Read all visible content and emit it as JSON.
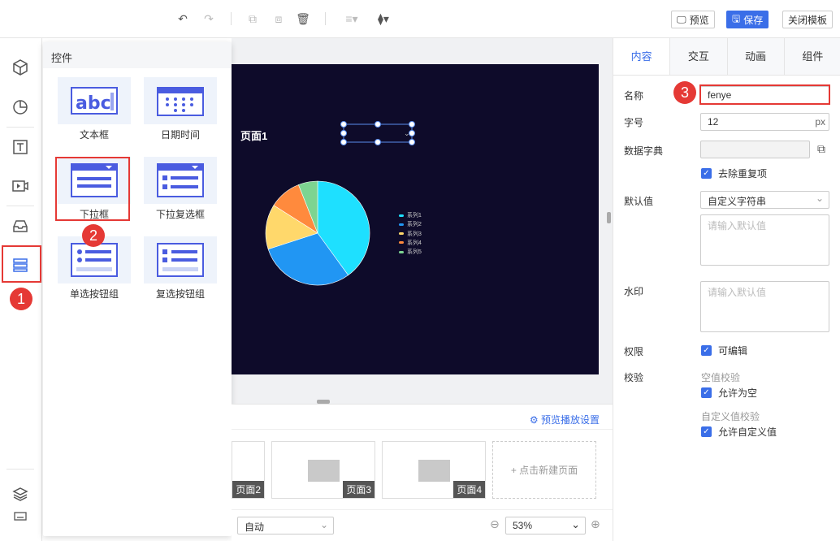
{
  "toolbar": {
    "preview_label": "预览",
    "save_label": "保存",
    "close_label": "关闭模板"
  },
  "panel": {
    "title": "控件",
    "controls": [
      {
        "label": "文本框"
      },
      {
        "label": "日期时间"
      },
      {
        "label": "下拉框"
      },
      {
        "label": "下拉复选框"
      },
      {
        "label": "单选按钮组"
      },
      {
        "label": "复选按钮组"
      }
    ]
  },
  "canvas": {
    "page_title": "页面1",
    "legend": [
      "系列1",
      "系列2",
      "系列3",
      "系列4",
      "系列5"
    ],
    "colors": [
      "#1ee0ff",
      "#2196f3",
      "#ffd86b",
      "#ff8a3d",
      "#7dd491"
    ]
  },
  "chart_data": {
    "type": "pie",
    "categories": [
      "系列1",
      "系列2",
      "系列3",
      "系列4",
      "系列5"
    ],
    "values": [
      40,
      30,
      14,
      10,
      6
    ]
  },
  "pages": {
    "preview_settings": "预览播放设置",
    "items": [
      "页面2",
      "页面3",
      "页面4"
    ],
    "new_page": "+ 点击新建页面",
    "auto_select": "自动",
    "zoom": "53%"
  },
  "rightpanel": {
    "tabs": [
      "内容",
      "交互",
      "动画",
      "组件"
    ],
    "name_label": "名称",
    "name_value": "fenye",
    "fontsize_label": "字号",
    "fontsize_value": "12",
    "fontsize_unit": "px",
    "dict_label": "数据字典",
    "dedupe_label": "去除重复项",
    "default_label": "默认值",
    "default_select": "自定义字符串",
    "default_placeholder": "请输入默认值",
    "watermark_label": "水印",
    "watermark_placeholder": "请输入默认值",
    "perm_label": "权限",
    "editable_label": "可编辑",
    "validate_label": "校验",
    "null_check": "空值校验",
    "allow_null": "允许为空",
    "custom_check": "自定义值校验",
    "allow_custom": "允许自定义值"
  },
  "badges": [
    "1",
    "2",
    "3"
  ]
}
